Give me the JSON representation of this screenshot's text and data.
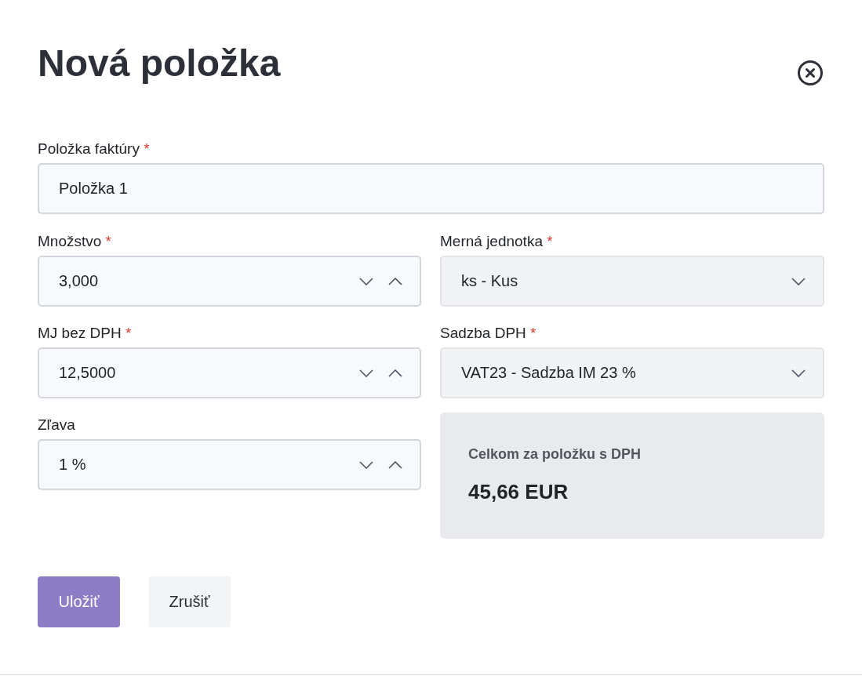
{
  "dialog": {
    "title": "Nová položka"
  },
  "invoice_item": {
    "kind": "text",
    "label": "Položka faktúry",
    "required_mark": "*",
    "value": "Položka 1"
  },
  "fields": [
    {
      "kind": "number",
      "label": "Množstvo",
      "required_mark": "*",
      "value": "3,000"
    },
    {
      "kind": "select",
      "label": "Merná jednotka",
      "required_mark": "*",
      "value": "ks - Kus"
    },
    {
      "kind": "number",
      "label": "MJ bez DPH",
      "required_mark": "*",
      "value": "12,5000"
    },
    {
      "kind": "select",
      "label": "Sadzba DPH",
      "required_mark": "*",
      "value": "VAT23 - Sadzba IM 23 %"
    },
    {
      "kind": "number",
      "label": "Zľava",
      "value": "1 %"
    }
  ],
  "summary": {
    "label": "Celkom za položku s DPH",
    "value": "45,66 EUR"
  },
  "buttons": [
    {
      "kind": "primary",
      "label": "Uložiť"
    },
    {
      "kind": "secondary",
      "label": "Zrušiť"
    }
  ]
}
